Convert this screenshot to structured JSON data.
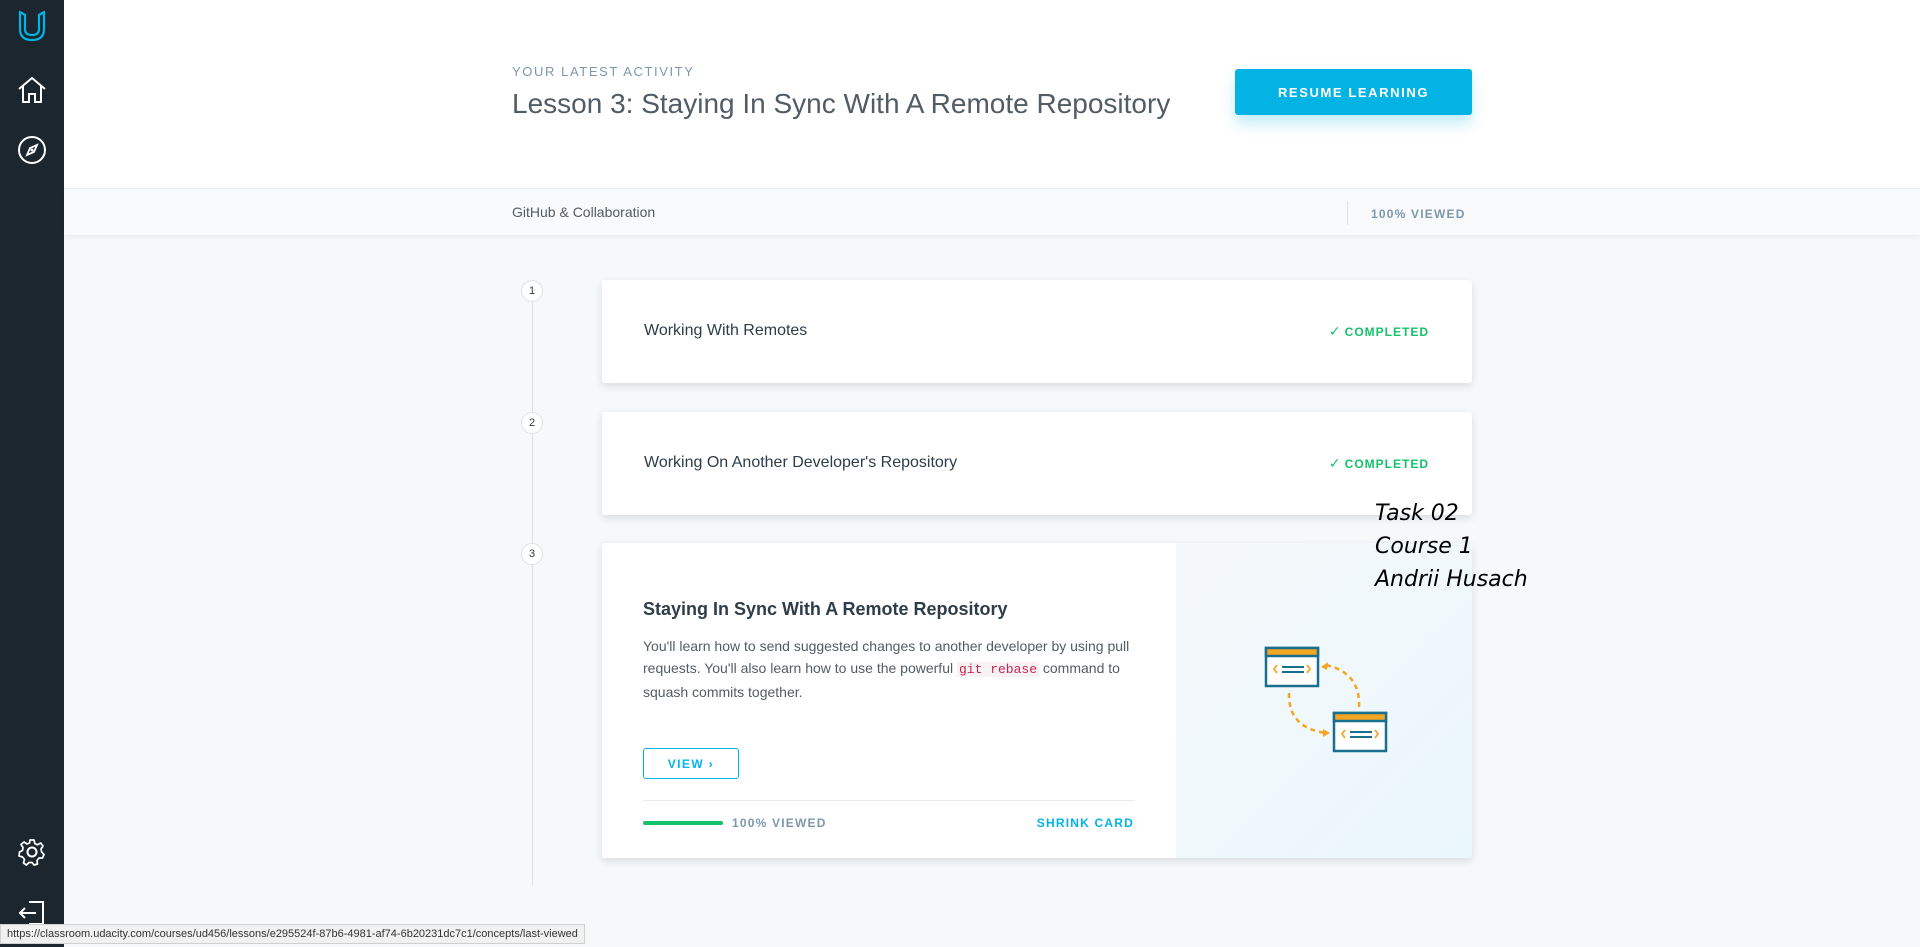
{
  "header": {
    "activity_label": "YOUR LATEST ACTIVITY",
    "lesson_title": "Lesson 3: Staying In Sync With A Remote Repository",
    "resume_label": "RESUME LEARNING"
  },
  "subbar": {
    "course_name": "GitHub & Collaboration",
    "viewed_label": "100% VIEWED"
  },
  "concepts": [
    {
      "number": "1",
      "title": "Working With Remotes",
      "status": "COMPLETED"
    },
    {
      "number": "2",
      "title": "Working On Another Developer's Repository",
      "status": "COMPLETED"
    },
    {
      "number": "3",
      "title": "Staying In Sync With A Remote Repository",
      "description_before": "You'll learn how to send suggested changes to another developer by using pull requests. You'll also learn how to use the powerful ",
      "description_code": "git rebase",
      "description_after": " command to squash commits together.",
      "view_label": "VIEW",
      "progress_fraction": 1.0,
      "progress_label": "100% VIEWED",
      "shrink_label": "SHRINK CARD"
    }
  ],
  "annotation": {
    "line1": "Task 02",
    "line2": "Course 1",
    "line3": "Andrii Husach"
  },
  "status_url": "https://classroom.udacity.com/courses/ud456/lessons/e295524f-87b6-4981-af74-6b20231dc7c1/concepts/last-viewed",
  "icons": {
    "logo": "udacity-logo-icon",
    "home": "home-icon",
    "explore": "compass-icon",
    "settings": "gear-icon",
    "logout": "logout-icon"
  },
  "colors": {
    "sidebar": "#1c262f",
    "accent": "#02b3e4",
    "success": "#15c26b"
  }
}
